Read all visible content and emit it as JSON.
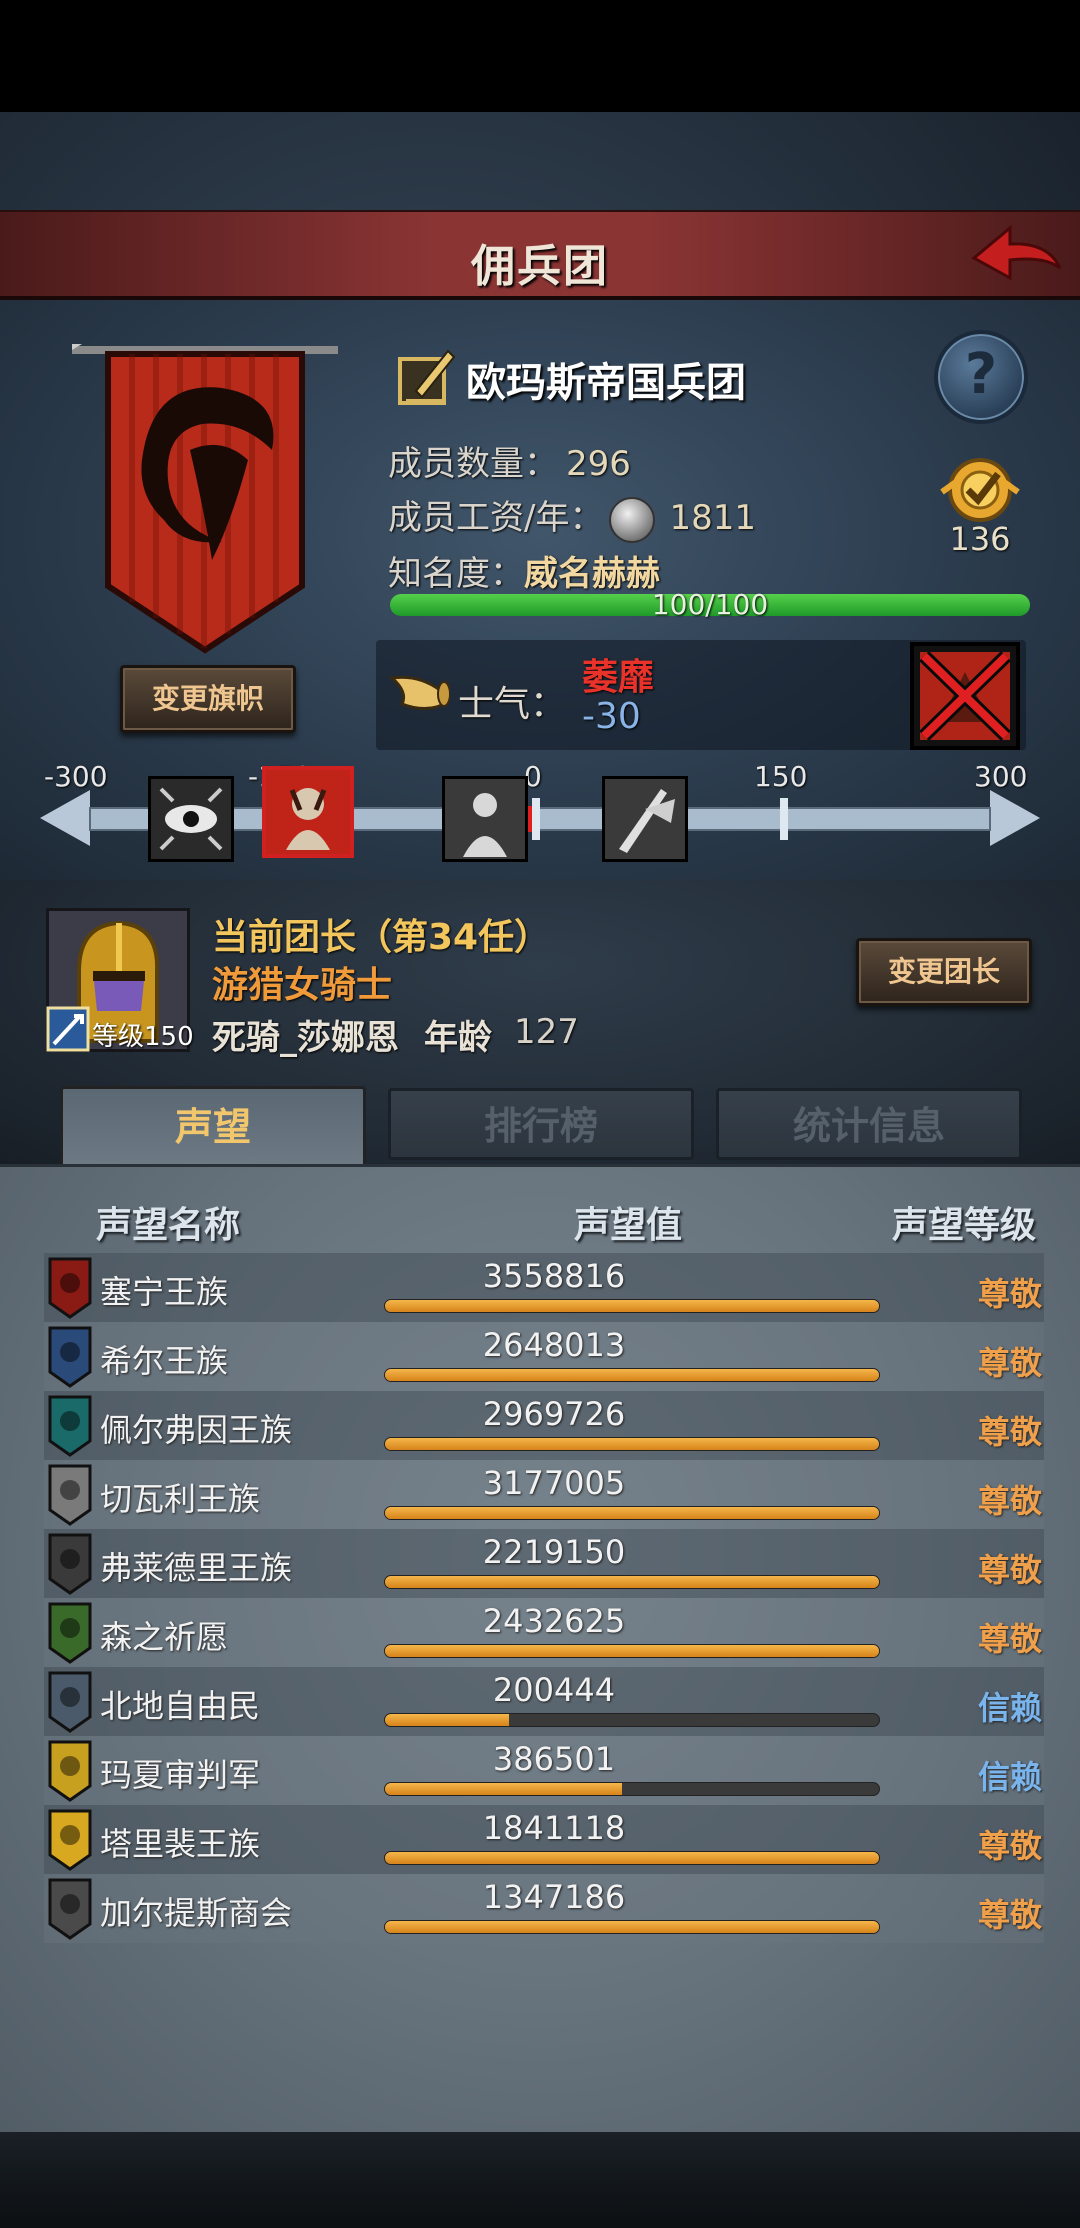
{
  "header": {
    "title": "佣兵团"
  },
  "legion": {
    "name": "欧玛斯帝国兵团",
    "members_label": "成员数量：",
    "members_value": "296",
    "wage_label": "成员工资/年：",
    "wage_value": "1811",
    "fame_label": "知名度：",
    "fame_value": "威名赫赫",
    "fame_progress_text": "100/100",
    "fame_progress": 1.0,
    "medal_value": "136",
    "change_banner_label": "变更旗帜",
    "help_symbol": "?"
  },
  "morale": {
    "label": "士气：",
    "status": "萎靡",
    "value": "-30",
    "scale_labels": [
      "-300",
      "-150",
      "0",
      "150",
      "300"
    ]
  },
  "commander": {
    "title": "当前团长（第34任）",
    "class": "游猎女骑士",
    "level_label": "等级",
    "level_value": "150",
    "name": "死骑_莎娜恩",
    "age_label": "年龄",
    "age_value": "127",
    "change_button_label": "变更团长"
  },
  "tabs": [
    {
      "label": "声望"
    },
    {
      "label": "排行榜"
    },
    {
      "label": "统计信息"
    }
  ],
  "table": {
    "headers": [
      "声望名称",
      "声望值",
      "声望等级"
    ],
    "rows": [
      {
        "name": "塞宁王族",
        "value": "3558816",
        "level": "尊敬",
        "progress": 1.0
      },
      {
        "name": "希尔王族",
        "value": "2648013",
        "level": "尊敬",
        "progress": 1.0
      },
      {
        "name": "佩尔弗因王族",
        "value": "2969726",
        "level": "尊敬",
        "progress": 1.0
      },
      {
        "name": "切瓦利王族",
        "value": "3177005",
        "level": "尊敬",
        "progress": 1.0
      },
      {
        "name": "弗莱德里王族",
        "value": "2219150",
        "level": "尊敬",
        "progress": 1.0
      },
      {
        "name": "森之祈愿",
        "value": "2432625",
        "level": "尊敬",
        "progress": 1.0
      },
      {
        "name": "北地自由民",
        "value": "200444",
        "level": "信赖",
        "progress": 0.25
      },
      {
        "name": "玛夏审判军",
        "value": "386501",
        "level": "信赖",
        "progress": 0.48
      },
      {
        "name": "塔里裴王族",
        "value": "1841118",
        "level": "尊敬",
        "progress": 1.0
      },
      {
        "name": "加尔提斯商会",
        "value": "1347186",
        "level": "尊敬",
        "progress": 1.0
      }
    ]
  },
  "colors": {
    "level_respect": "#f0a04a",
    "level_trust": "#7ab4ec"
  }
}
